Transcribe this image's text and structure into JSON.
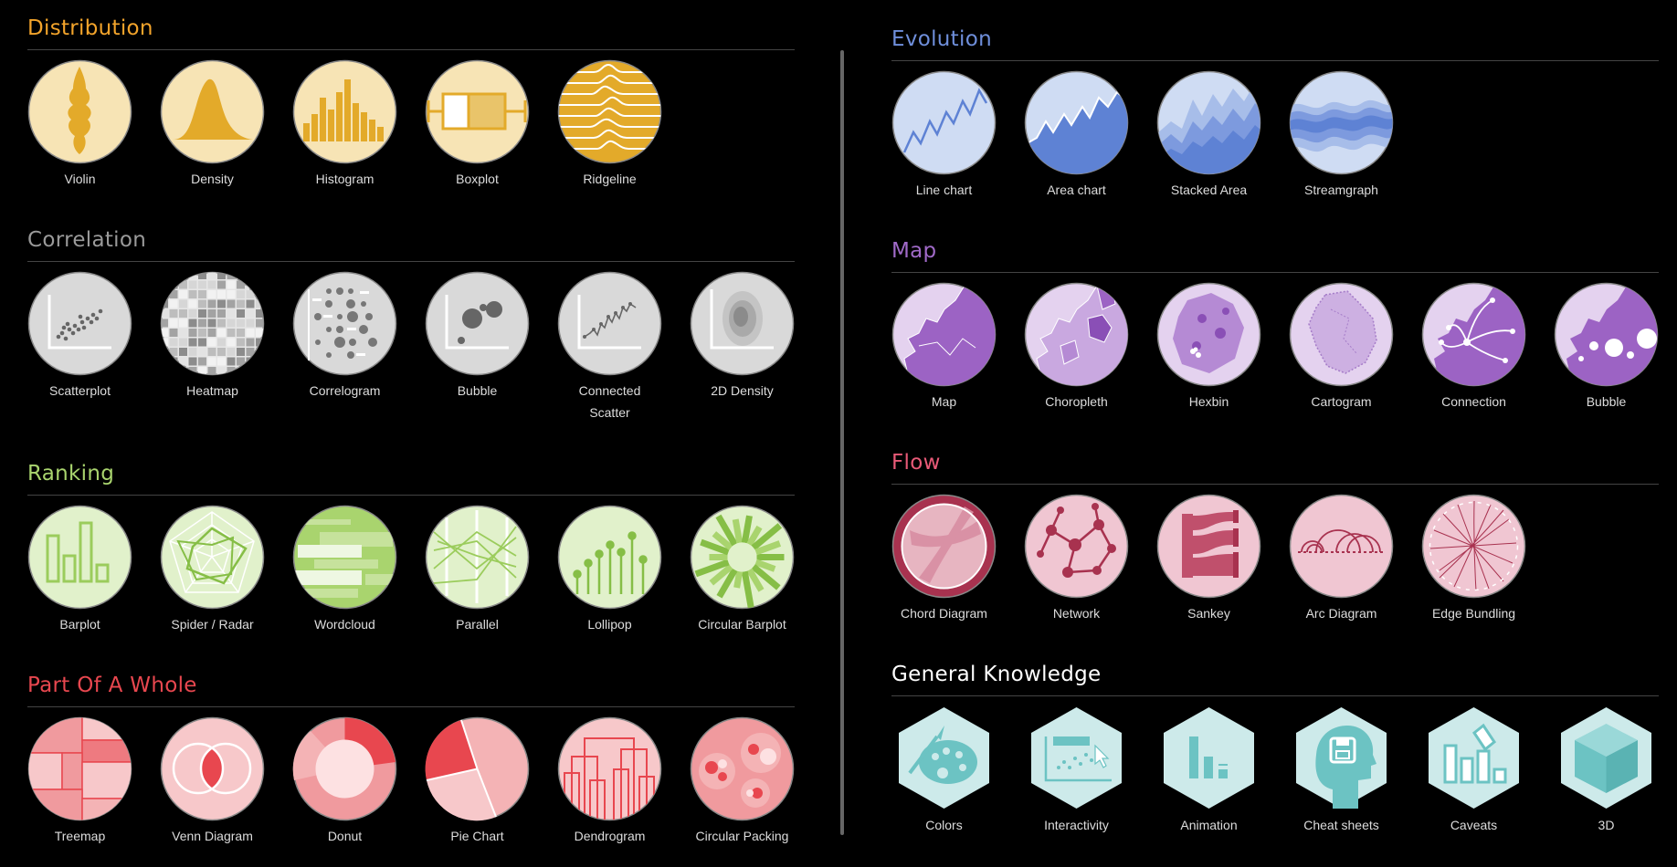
{
  "colors": {
    "distribution": "#f3a42b",
    "correlation": "#9a9a9a",
    "ranking": "#a9d46e",
    "part_of_whole": "#e8474f",
    "evolution": "#6f8fdb",
    "map": "#a06ac8",
    "flow": "#e85a77",
    "general": "#ffffff"
  },
  "sections": {
    "distribution": {
      "title": "Distribution",
      "items": [
        {
          "label": "Violin",
          "icon": "violin-icon"
        },
        {
          "label": "Density",
          "icon": "density-icon"
        },
        {
          "label": "Histogram",
          "icon": "histogram-icon"
        },
        {
          "label": "Boxplot",
          "icon": "boxplot-icon"
        },
        {
          "label": "Ridgeline",
          "icon": "ridgeline-icon"
        }
      ]
    },
    "correlation": {
      "title": "Correlation",
      "items": [
        {
          "label": "Scatterplot",
          "icon": "scatterplot-icon"
        },
        {
          "label": "Heatmap",
          "icon": "heatmap-icon"
        },
        {
          "label": "Correlogram",
          "icon": "correlogram-icon"
        },
        {
          "label": "Bubble",
          "icon": "bubble-icon"
        },
        {
          "label": "Connected Scatter",
          "icon": "connected-scatter-icon"
        },
        {
          "label": "2D Density",
          "icon": "2d-density-icon"
        }
      ]
    },
    "ranking": {
      "title": "Ranking",
      "items": [
        {
          "label": "Barplot",
          "icon": "barplot-icon"
        },
        {
          "label": "Spider / Radar",
          "icon": "radar-icon"
        },
        {
          "label": "Wordcloud",
          "icon": "wordcloud-icon"
        },
        {
          "label": "Parallel",
          "icon": "parallel-icon"
        },
        {
          "label": "Lollipop",
          "icon": "lollipop-icon"
        },
        {
          "label": "Circular Barplot",
          "icon": "circular-barplot-icon"
        }
      ]
    },
    "part_of_whole": {
      "title": "Part Of A Whole",
      "items": [
        {
          "label": "Treemap",
          "icon": "treemap-icon"
        },
        {
          "label": "Venn Diagram",
          "icon": "venn-icon"
        },
        {
          "label": "Donut",
          "icon": "donut-icon"
        },
        {
          "label": "Pie Chart",
          "icon": "pie-icon"
        },
        {
          "label": "Dendrogram",
          "icon": "dendrogram-icon"
        },
        {
          "label": "Circular Packing",
          "icon": "circular-packing-icon"
        }
      ]
    },
    "evolution": {
      "title": "Evolution",
      "items": [
        {
          "label": "Line chart",
          "icon": "line-chart-icon"
        },
        {
          "label": "Area chart",
          "icon": "area-chart-icon"
        },
        {
          "label": "Stacked Area",
          "icon": "stacked-area-icon"
        },
        {
          "label": "Streamgraph",
          "icon": "streamgraph-icon"
        }
      ]
    },
    "map": {
      "title": "Map",
      "items": [
        {
          "label": "Map",
          "icon": "map-icon"
        },
        {
          "label": "Choropleth",
          "icon": "choropleth-icon"
        },
        {
          "label": "Hexbin",
          "icon": "hexbin-map-icon"
        },
        {
          "label": "Cartogram",
          "icon": "cartogram-icon"
        },
        {
          "label": "Connection",
          "icon": "connection-map-icon"
        },
        {
          "label": "Bubble",
          "icon": "bubble-map-icon"
        }
      ]
    },
    "flow": {
      "title": "Flow",
      "items": [
        {
          "label": "Chord Diagram",
          "icon": "chord-icon"
        },
        {
          "label": "Network",
          "icon": "network-icon"
        },
        {
          "label": "Sankey",
          "icon": "sankey-icon"
        },
        {
          "label": "Arc Diagram",
          "icon": "arc-diagram-icon"
        },
        {
          "label": "Edge Bundling",
          "icon": "edge-bundling-icon"
        }
      ]
    },
    "general": {
      "title": "General Knowledge",
      "items": [
        {
          "label": "Colors",
          "icon": "palette-icon"
        },
        {
          "label": "Interactivity",
          "icon": "interactivity-icon"
        },
        {
          "label": "Animation",
          "icon": "animation-icon"
        },
        {
          "label": "Cheat sheets",
          "icon": "cheat-sheets-icon"
        },
        {
          "label": "Caveats",
          "icon": "caveats-icon"
        },
        {
          "label": "3D",
          "icon": "cube-3d-icon"
        }
      ]
    }
  }
}
